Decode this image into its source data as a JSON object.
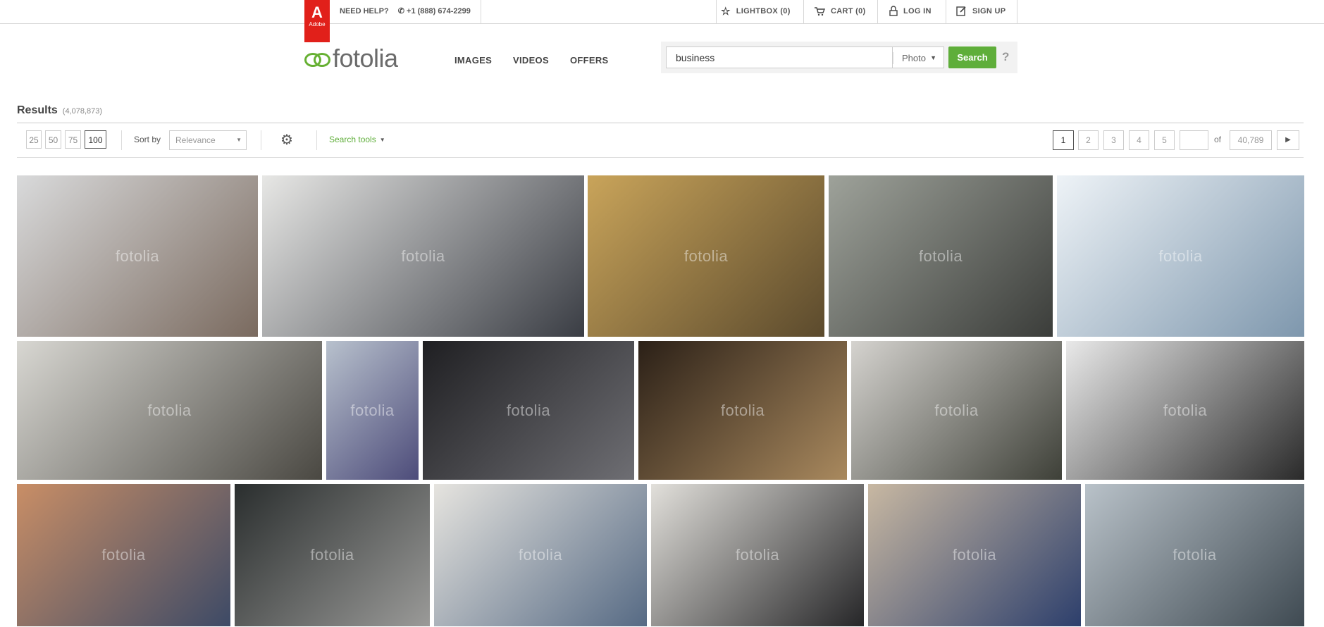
{
  "topbar": {
    "help_label": "NEED HELP?",
    "phone": "+1 (888) 674-2299",
    "adobe_glyph": "A",
    "adobe_text": "Adobe",
    "lightbox": "LIGHTBOX (0)",
    "cart": "CART (0)",
    "login": "LOG IN",
    "signup": "SIGN UP"
  },
  "brand": {
    "name": "fotolia"
  },
  "nav": {
    "images": "IMAGES",
    "videos": "VIDEOS",
    "offers": "OFFERS"
  },
  "search": {
    "query": "business",
    "type": "Photo",
    "button": "Search",
    "help": "?"
  },
  "results": {
    "title": "Results",
    "count": "(4,078,873)"
  },
  "toolbar": {
    "per_page": [
      "25",
      "50",
      "75",
      "100"
    ],
    "per_page_selected": "100",
    "sort_label": "Sort by",
    "sort_value": "Relevance",
    "search_tools": "Search tools"
  },
  "pagination": {
    "pages": [
      "1",
      "2",
      "3",
      "4",
      "5"
    ],
    "current": "1",
    "page_input": "",
    "of_label": "of",
    "total": "40,789"
  },
  "watermark": "fotolia",
  "icons": {
    "phone": "phone-icon",
    "lightbox": "star-icon",
    "cart": "cart-icon",
    "login": "lock-icon",
    "signup": "edit-icon",
    "gear": "gear-icon",
    "next": "next-arrow-icon"
  },
  "colors": {
    "brand_green": "#5fae3a",
    "adobe_red": "#e1201a"
  },
  "images": [
    {
      "name": "image-office-meeting-woman",
      "palette": [
        "#d9dadb",
        "#7a6a5f"
      ]
    },
    {
      "name": "image-computer-desk-typing",
      "palette": [
        "#e7e7e5",
        "#3a3d44"
      ]
    },
    {
      "name": "image-plant-coin-jar",
      "palette": [
        "#c9a45a",
        "#5b4a2d"
      ]
    },
    {
      "name": "image-businessman-money-rain",
      "palette": [
        "#9ea29a",
        "#3b3d3a"
      ]
    },
    {
      "name": "image-hand-globe",
      "palette": [
        "#eef3f7",
        "#7e97ad"
      ]
    },
    {
      "name": "image-conference-audience",
      "palette": [
        "#d8d7d2",
        "#4a4842"
      ]
    },
    {
      "name": "image-woman-computer-office",
      "palette": [
        "#b8c1cd",
        "#4d4c7a"
      ]
    },
    {
      "name": "image-man-tablet-apps",
      "palette": [
        "#1f1f22",
        "#6e6e73"
      ]
    },
    {
      "name": "image-woman-night-computer",
      "palette": [
        "#2b2017",
        "#a9895e"
      ]
    },
    {
      "name": "image-businessman-newspaper",
      "palette": [
        "#d5d3cf",
        "#3e4038"
      ]
    },
    {
      "name": "image-empty-office-silhouette",
      "palette": [
        "#e9e9e9",
        "#2a2a2a"
      ]
    },
    {
      "name": "image-team-laptop-laughing",
      "palette": [
        "#c98e66",
        "#3d4a66"
      ]
    },
    {
      "name": "image-efficiency-chalkboard",
      "palette": [
        "#2a2e2e",
        "#9a9a98"
      ]
    },
    {
      "name": "image-men-office-smiling",
      "palette": [
        "#e6e4df",
        "#566a84"
      ]
    },
    {
      "name": "image-business-team-group",
      "palette": [
        "#e2e0db",
        "#262628"
      ]
    },
    {
      "name": "image-couple-tablet-cafe",
      "palette": [
        "#c8b8a2",
        "#2d3f6c"
      ]
    },
    {
      "name": "image-presentation-room",
      "palette": [
        "#b9c2c9",
        "#3f4a52"
      ]
    }
  ]
}
